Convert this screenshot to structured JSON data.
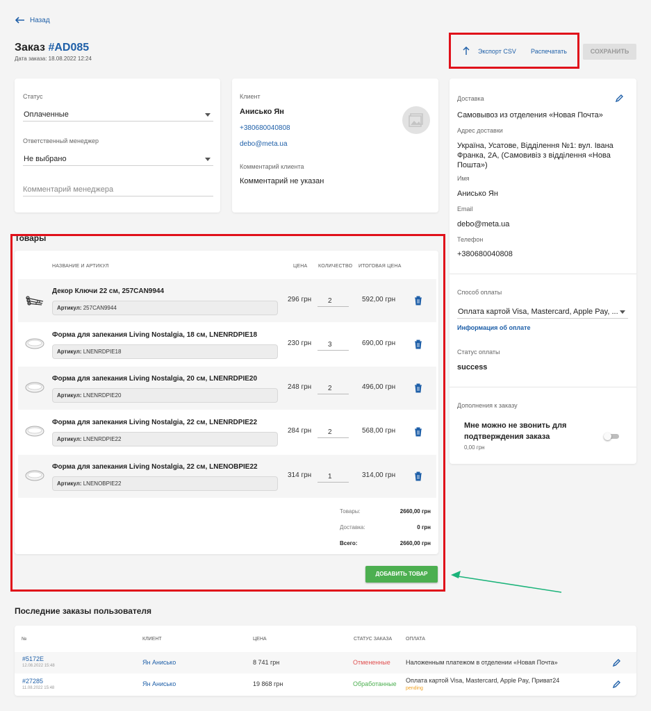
{
  "nav": {
    "back_label": "Назад"
  },
  "header": {
    "title_prefix": "Заказ",
    "order_id": "#AD085",
    "date_label": "Дата заказа: 18.08.2022 12:24",
    "export_label": "Экспорт CSV",
    "print_label": "Распечатать",
    "save_label": "СОХРАНИТЬ"
  },
  "status_card": {
    "status_label": "Статус",
    "status_value": "Оплаченные",
    "manager_label": "Ответственный менеджер",
    "manager_value": "Не выбрано",
    "comment_placeholder": "Комментарий менеджера"
  },
  "client_card": {
    "label": "Клиент",
    "name": "Анисько Ян",
    "phone": "+380680040808",
    "email": "debo@meta.ua",
    "comment_label": "Комментарий клиента",
    "comment_value": "Комментарий не указан"
  },
  "delivery": {
    "label": "Доставка",
    "method": "Самовывоз из отделения «Новая Почта»",
    "address_label": "Адрес доставки",
    "address": "Україна, Усатове, Відділення №1: вул. Івана Франка, 2А, (Самовивіз з відділення «Нова Пошта»)",
    "name_label": "Имя",
    "name": "Анисько Ян",
    "email_label": "Email",
    "email": "debo@meta.ua",
    "phone_label": "Телефон",
    "phone": "+380680040808"
  },
  "payment": {
    "method_label": "Способ оплаты",
    "method_value": "Оплата картой Visa, Mastercard, Apple Pay, ...",
    "info_link": "Информация об оплате",
    "status_label": "Статус оплаты",
    "status_value": "success"
  },
  "addons": {
    "label": "Дополнения к заказу",
    "item_title": "Мне можно не звонить для подтверждения заказа",
    "item_price": "0,00 грн",
    "toggle_on": false
  },
  "products": {
    "section_title": "Товары",
    "columns": {
      "name": "НАЗВАНИЕ И АРТИКУЛ",
      "price": "ЦЕНА",
      "qty": "КОЛИЧЕСТВО",
      "total": "ИТОГОВАЯ ЦЕНА"
    },
    "sku_prefix": "Артикул:",
    "items": [
      {
        "name": "Декор Ключи 22 см, 257CAN9944",
        "sku": "257CAN9944",
        "price": "296 грн",
        "qty": "2",
        "total": "592,00 грн"
      },
      {
        "name": "Форма для запекания Living Nostalgia, 18 см, LNENRDPIE18",
        "sku": "LNENRDPIE18",
        "price": "230 грн",
        "qty": "3",
        "total": "690,00 грн"
      },
      {
        "name": "Форма для запекания Living Nostalgia, 20 см, LNENRDPIE20",
        "sku": "LNENRDPIE20",
        "price": "248 грн",
        "qty": "2",
        "total": "496,00 грн"
      },
      {
        "name": "Форма для запекания Living Nostalgia, 22 см, LNENRDPIE22",
        "sku": "LNENRDPIE22",
        "price": "284 грн",
        "qty": "2",
        "total": "568,00 грн"
      },
      {
        "name": "Форма для запекания Living Nostalgia, 22 см, LNENOBPIE22",
        "sku": "LNENOBPIE22",
        "price": "314 грн",
        "qty": "1",
        "total": "314,00 грн"
      }
    ],
    "summary": {
      "goods_label": "Товары:",
      "goods_value": "2660,00 грн",
      "delivery_label": "Доставка:",
      "delivery_value": "0 грн",
      "total_label": "Всего:",
      "total_value": "2660,00 грн"
    },
    "add_button": "ДОБАВИТЬ ТОВАР"
  },
  "recent_orders": {
    "title": "Последние заказы пользователя",
    "columns": {
      "num": "№",
      "client": "КЛИЕНТ",
      "price": "ЦЕНА",
      "status": "СТАТУС ЗАКАЗА",
      "payment": "ОПЛАТА"
    },
    "rows": [
      {
        "id": "#5172E",
        "date": "12.08.2022 15:48",
        "client": "Ян Анисько",
        "price": "8 741 грн",
        "status": "Отмененные",
        "payment": "Наложенным платежом в отделении «Новая Почта»",
        "payment_status": ""
      },
      {
        "id": "#27285",
        "date": "11.08.2022 15:48",
        "client": "Ян Анисько",
        "price": "19 868 грн",
        "status": "Обработанные",
        "payment": "Оплата картой Visa, Mastercard, Apple Pay, Приват24",
        "payment_status": "pending"
      }
    ]
  },
  "colors": {
    "accent_blue": "#1e5fa8",
    "highlight_red": "#e0101a",
    "add_button_green": "#4caf50",
    "arrow_green": "#1bb37a",
    "status_cancelled": "#e05050",
    "status_processed": "#4caf50",
    "pending_orange": "#f0a020"
  }
}
